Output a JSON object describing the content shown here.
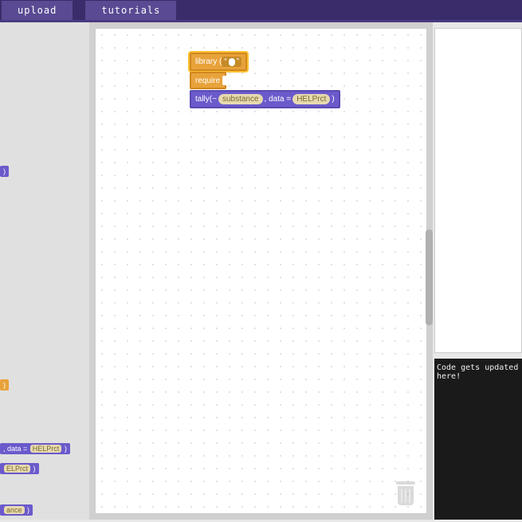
{
  "topbar": {
    "upload": "upload",
    "tutorials": "tutorials"
  },
  "sidebar": {
    "frag1_suffix": ")",
    "frag2_suffix": ")",
    "frag3_prefix": ", data =",
    "frag3_val": "HELPrct",
    "frag3_suffix": ")",
    "frag4_val": "ELPrct",
    "frag4_suffix": ")",
    "frag5_val": "ance",
    "frag5_suffix": ")"
  },
  "workspace": {
    "block1": {
      "label": "library  (",
      "quote_l": "“",
      "quote_r": "”"
    },
    "block2": {
      "label": "require"
    },
    "block3": {
      "label": "tally(~",
      "var1": "substance",
      "mid": ", data =",
      "var2": "HELPrct",
      "suffix": ")"
    }
  },
  "code_panel": {
    "placeholder": "Code gets updated here!"
  }
}
